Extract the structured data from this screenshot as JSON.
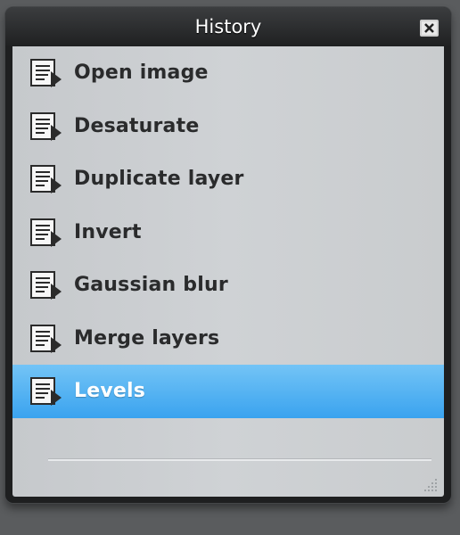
{
  "window": {
    "title": "History"
  },
  "history": {
    "items": [
      {
        "label": "Open image",
        "icon": "history-step-icon",
        "selected": false
      },
      {
        "label": "Desaturate",
        "icon": "history-step-icon",
        "selected": false
      },
      {
        "label": "Duplicate layer",
        "icon": "history-step-icon",
        "selected": false
      },
      {
        "label": "Invert",
        "icon": "history-step-icon",
        "selected": false
      },
      {
        "label": "Gaussian blur",
        "icon": "history-step-icon",
        "selected": false
      },
      {
        "label": "Merge layers",
        "icon": "history-step-icon",
        "selected": false
      },
      {
        "label": "Levels",
        "icon": "history-step-icon",
        "selected": true
      }
    ]
  },
  "colors": {
    "selection": "#3aa3ef",
    "panel": "#cfd2d5",
    "titlebar": "#1f2021"
  }
}
